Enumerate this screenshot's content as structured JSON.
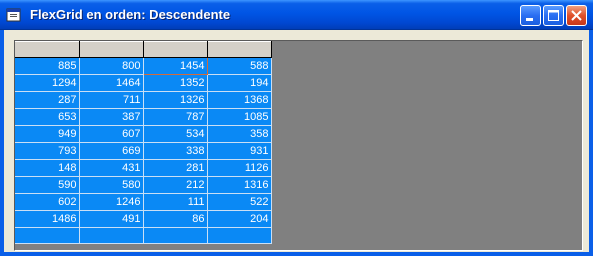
{
  "window": {
    "title": "FlexGrid en orden: Descendente"
  },
  "grid": {
    "headers": [
      "",
      "",
      "",
      ""
    ],
    "rows": [
      [
        "885",
        "800",
        "1454",
        "588"
      ],
      [
        "1294",
        "1464",
        "1352",
        "194"
      ],
      [
        "287",
        "711",
        "1326",
        "1368"
      ],
      [
        "653",
        "387",
        "787",
        "1085"
      ],
      [
        "949",
        "607",
        "534",
        "358"
      ],
      [
        "793",
        "669",
        "338",
        "931"
      ],
      [
        "148",
        "431",
        "281",
        "1126"
      ],
      [
        "590",
        "580",
        "212",
        "1316"
      ],
      [
        "602",
        "1246",
        "111",
        "522"
      ],
      [
        "1486",
        "491",
        "86",
        "204"
      ],
      [
        "",
        "",
        "",
        ""
      ]
    ],
    "current_cell": {
      "row": 1,
      "col": 3
    }
  },
  "colors": {
    "titlebar": "#0055e5",
    "cell_selection": "#0a89f5",
    "grid_background": "#808080"
  }
}
